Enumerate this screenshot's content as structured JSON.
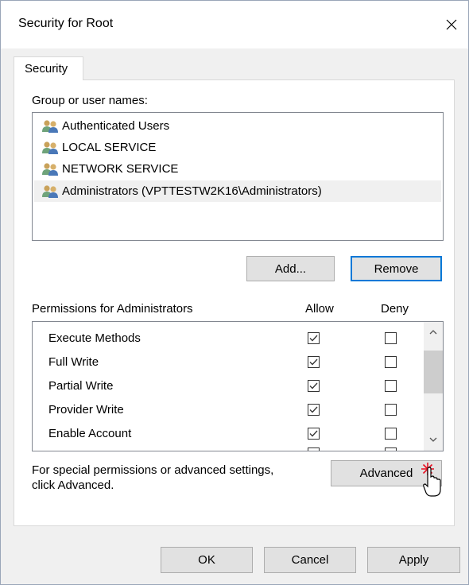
{
  "window": {
    "title": "Security for Root"
  },
  "tabs": [
    {
      "label": "Security"
    }
  ],
  "users_section": {
    "label": "Group or user names:",
    "users": [
      {
        "name": "Authenticated Users",
        "icon": "users-icon",
        "selected": false
      },
      {
        "name": "LOCAL SERVICE",
        "icon": "users-icon",
        "selected": false
      },
      {
        "name": "NETWORK SERVICE",
        "icon": "users-icon",
        "selected": false
      },
      {
        "name": "Administrators (VPTTESTW2K16\\Administrators)",
        "icon": "users-icon",
        "selected": true
      }
    ],
    "add_label": "Add...",
    "remove_label": "Remove"
  },
  "permissions": {
    "label": "Permissions for Administrators",
    "allow_header": "Allow",
    "deny_header": "Deny",
    "rows": [
      {
        "name": "Execute Methods",
        "allow": true,
        "deny": false
      },
      {
        "name": "Full Write",
        "allow": true,
        "deny": false
      },
      {
        "name": "Partial Write",
        "allow": true,
        "deny": false
      },
      {
        "name": "Provider Write",
        "allow": true,
        "deny": false
      },
      {
        "name": "Enable Account",
        "allow": true,
        "deny": false
      }
    ]
  },
  "advanced": {
    "text_line1": "For special permissions or advanced settings,",
    "text_line2": "click Advanced.",
    "button_label": "Advanced"
  },
  "footer": {
    "ok_label": "OK",
    "cancel_label": "Cancel",
    "apply_label": "Apply"
  },
  "colors": {
    "focus_border": "#0078d7",
    "selection_bg": "#f0f0f0",
    "click_marker": "#e81123"
  }
}
